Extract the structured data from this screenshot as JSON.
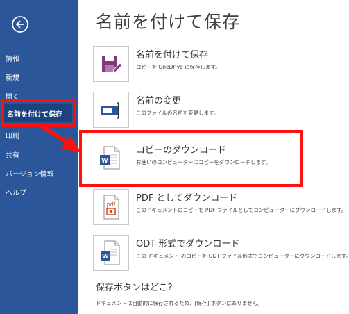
{
  "sidebar": {
    "items": [
      {
        "label": "情報"
      },
      {
        "label": "新規"
      },
      {
        "label": "開く"
      },
      {
        "label": "名前を付けて保存"
      },
      {
        "label": "印刷"
      },
      {
        "label": "共有"
      },
      {
        "label": "バージョン情報"
      },
      {
        "label": "ヘルプ"
      }
    ],
    "selected": "名前を付けて保存"
  },
  "main": {
    "title": "名前を付けて保存",
    "options": [
      {
        "title": "名前を付けて保存",
        "desc": "コピーを OneDrive に保存します。",
        "icon": "save-as-icon"
      },
      {
        "title": "名前の変更",
        "desc": "このファイルの名前を変更します。",
        "icon": "rename-icon"
      },
      {
        "title": "コピーのダウンロード",
        "desc": "お使いのコンピューターにコピーをダウンロードします。",
        "icon": "word-document-icon"
      },
      {
        "title": "PDF としてダウンロード",
        "desc": "このドキュメントのコピーを PDF ファイルとしてコンピューターにダウンロードします。",
        "icon": "pdf-document-icon"
      },
      {
        "title": "ODT 形式でダウンロード",
        "desc": "この ドキュメント のコピーを ODT ファイル形式でコンピューターにダウンロードします。",
        "icon": "odt-document-icon"
      }
    ],
    "save_button_question": "保存ボタンはどこ?",
    "save_button_note": "ドキュメントは自動的に保存されるため、[保存] ボタンはありません。"
  },
  "colors": {
    "sidebar_bg": "#2b579a",
    "highlight": "#ff1010",
    "icon_purple": "#80397b",
    "icon_blue": "#2b579a",
    "icon_pdf": "#d04a23"
  }
}
